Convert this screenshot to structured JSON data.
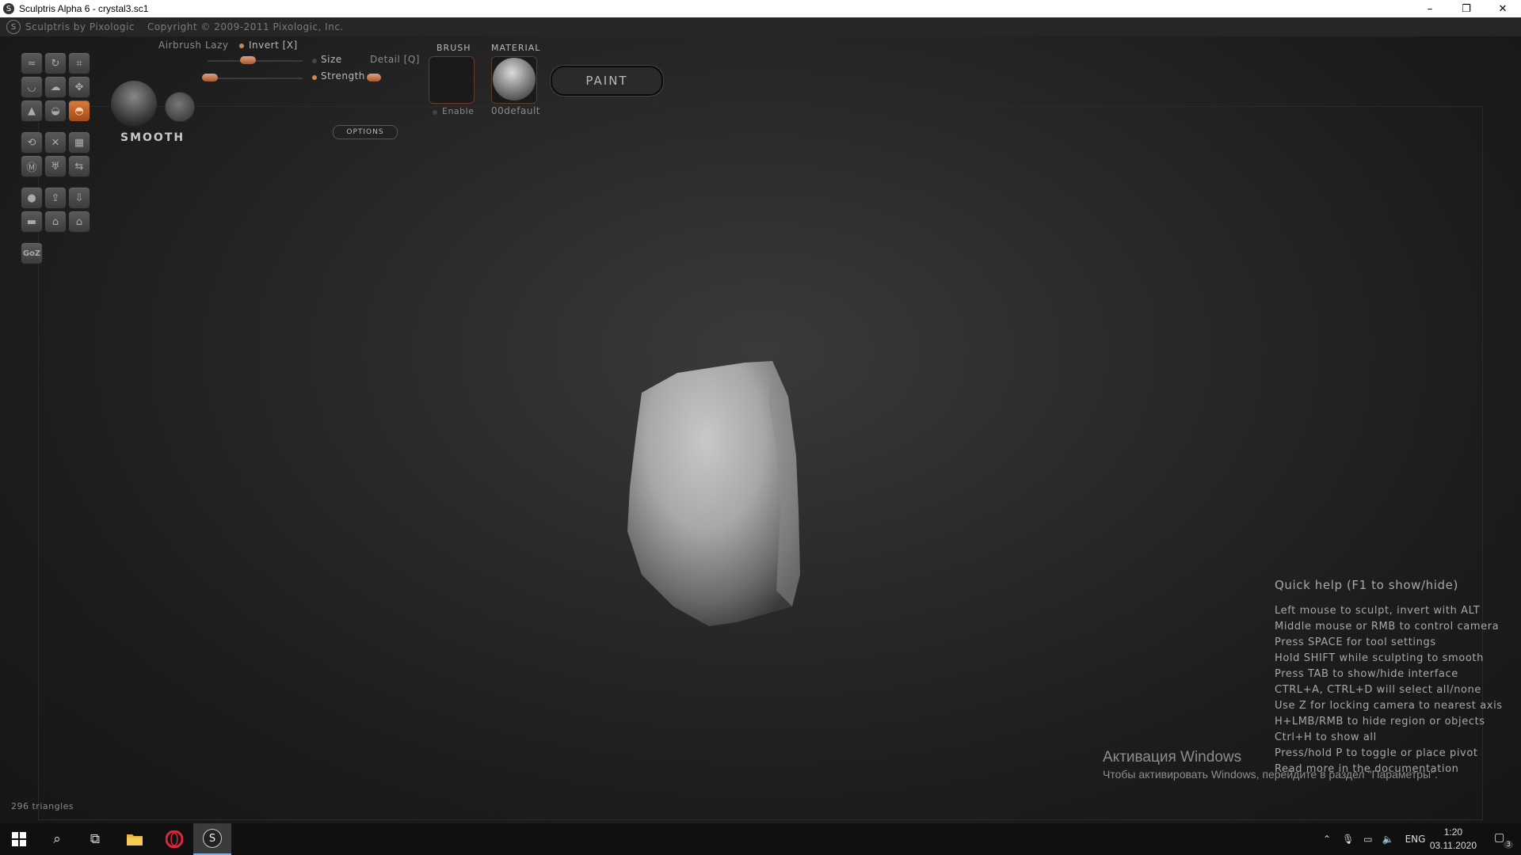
{
  "window": {
    "title": "Sculptris Alpha 6 - crystal3.sc1",
    "minimize": "–",
    "restore": "❐",
    "close": "✕"
  },
  "appbar": {
    "brand": "Sculptris by Pixologic",
    "copyright": "Copyright © 2009-2011 Pixologic, Inc."
  },
  "toolbar": {
    "brush_name": "SMOOTH",
    "airbrush": "Airbrush",
    "lazy": "Lazy",
    "invert": "Invert [X]",
    "size": "Size",
    "detail": "Detail [Q]",
    "strength": "Strength",
    "options": "OPTIONS",
    "brush_label": "BRUSH",
    "enable": "Enable",
    "material_label": "MATERIAL",
    "material_name": "00default",
    "paint": "PAINT",
    "goz": "GoZ"
  },
  "quickhelp": {
    "title": "Quick help (F1 to show/hide)",
    "lines": [
      "Left mouse to sculpt, invert with ALT",
      "Middle mouse or RMB to control camera",
      "Press SPACE for tool settings",
      "Hold SHIFT while sculpting to smooth",
      "Press TAB to show/hide interface",
      "CTRL+A, CTRL+D will select all/none",
      "Use Z for locking camera to nearest axis",
      "H+LMB/RMB to hide region or objects",
      "Ctrl+H to show all",
      "Press/hold P to toggle or place pivot",
      "Read more in the documentation"
    ]
  },
  "activation": {
    "title": "Активация Windows",
    "subtitle": "Чтобы активировать Windows, перейдите в раздел \"Параметры\"."
  },
  "status": {
    "triangles": "296 triangles"
  },
  "taskbar": {
    "language": "ENG",
    "time": "1:20",
    "date": "03.11.2020",
    "notifications": "3"
  },
  "colors": {
    "accent": "#d08850",
    "active_tool": "#c0652a"
  }
}
